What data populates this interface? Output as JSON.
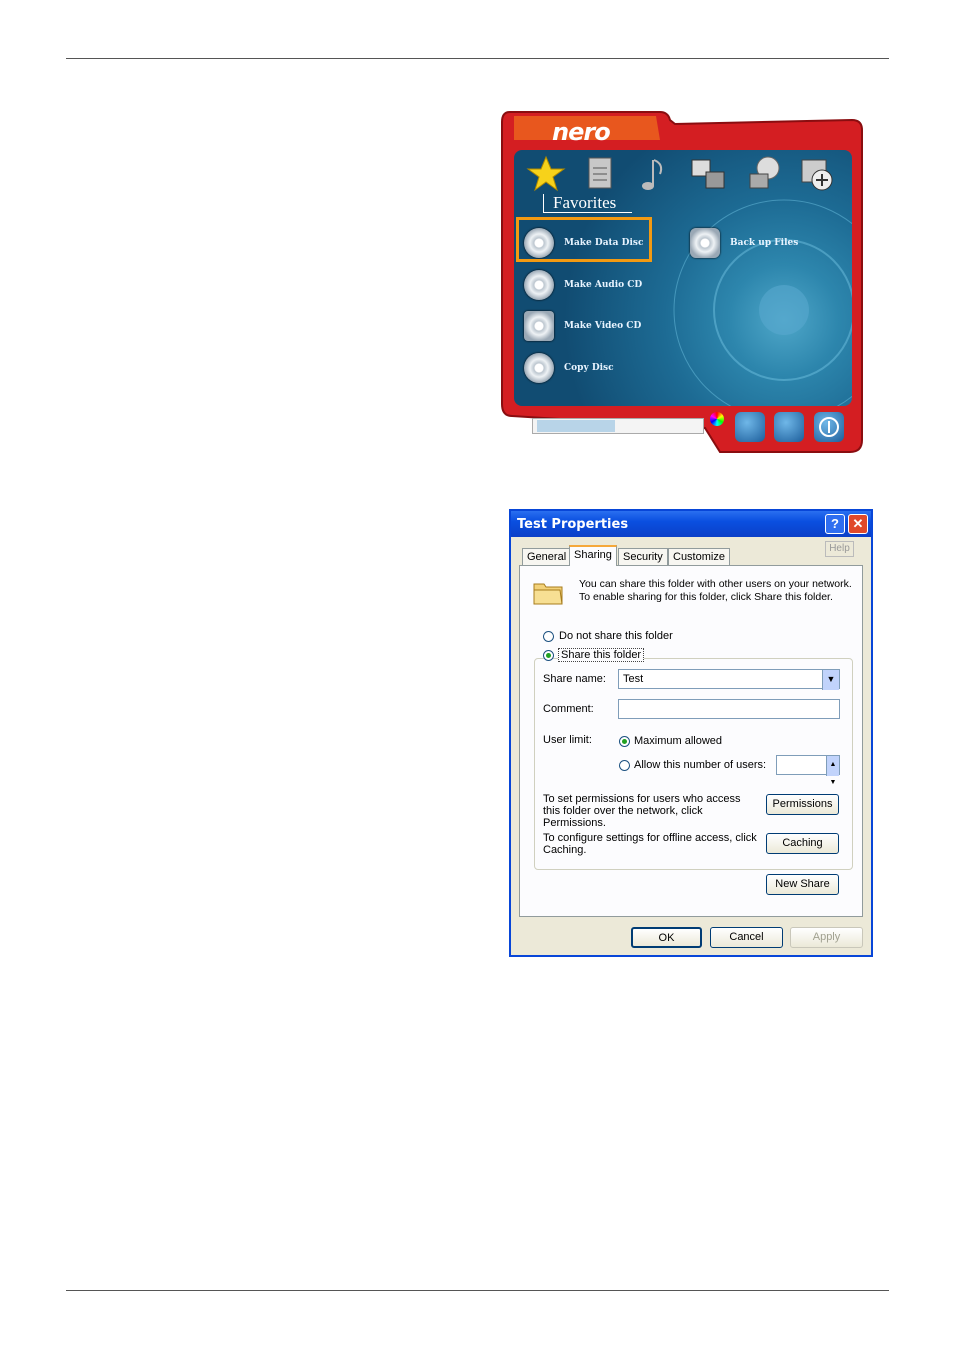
{
  "nero": {
    "logo": "nero",
    "section_label": "Favorites",
    "toolbar_icons": [
      "star-icon",
      "document-icon",
      "music-note-icon",
      "video-icon",
      "copy-disc-icon",
      "add-icon"
    ],
    "items": [
      {
        "label": "Make Data Disc",
        "icon": "data-disc-icon",
        "highlighted": true
      },
      {
        "label": "Make Audio CD",
        "icon": "audio-cd-icon"
      },
      {
        "label": "Make Video CD",
        "icon": "vcd-icon"
      },
      {
        "label": "Copy Disc",
        "icon": "copy-disc-icon"
      }
    ],
    "right_item": {
      "label": "Back up Files",
      "icon": "backup-icon"
    },
    "highlight_color": "#f39a12",
    "frame_color": "#d41e22"
  },
  "dialog": {
    "title": "Test Properties",
    "help_button": "?",
    "close_button": "✕",
    "help_ghost": "Help",
    "tabs": [
      "General",
      "Sharing",
      "Security",
      "Customize"
    ],
    "active_tab": "Sharing",
    "intro": "You can share this folder with other users on your network.  To enable sharing for this folder, click Share this folder.",
    "radio_no_share": "Do not share this folder",
    "radio_share": "Share this folder",
    "share_name_label": "Share name:",
    "share_name_value": "Test",
    "comment_label": "Comment:",
    "comment_value": "",
    "user_limit_label": "User limit:",
    "radio_max": "Maximum allowed",
    "radio_allow": "Allow this number of users:",
    "permissions_text": "To set permissions for users who access this folder over the network, click Permissions.",
    "permissions_button": "Permissions",
    "caching_text": "To configure settings for offline access, click Caching.",
    "caching_button": "Caching",
    "new_share_button": "New Share",
    "ok_button": "OK",
    "cancel_button": "Cancel",
    "apply_button": "Apply"
  }
}
